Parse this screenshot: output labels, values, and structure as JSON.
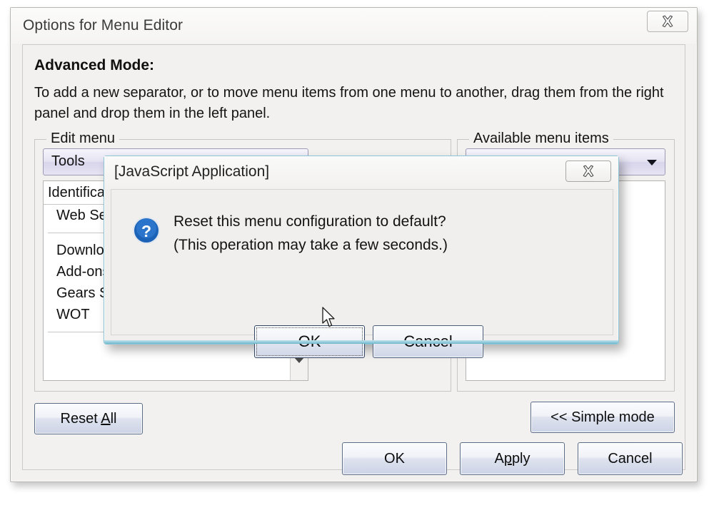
{
  "window": {
    "title": "Options for Menu Editor",
    "close_icon": "close-icon"
  },
  "content": {
    "heading": "Advanced Mode:",
    "description": "To add a new separator, or to move menu items from one menu to another, drag them from the right panel and drop them in the left panel."
  },
  "left_panel": {
    "group_label": "Edit menu",
    "combo_value": "Tools",
    "combo_arrow_icon": "chevron-down-icon",
    "list_header": "Identification",
    "items": [
      {
        "label": "Web Services"
      },
      {
        "label": "Downloads"
      },
      {
        "label": "Add-ons"
      },
      {
        "label": "Gears Settings"
      },
      {
        "label": "WOT"
      }
    ],
    "scroll_down_icon": "chevron-down-icon"
  },
  "right_panel": {
    "group_label": "Available menu items",
    "combo_value": "",
    "combo_arrow_icon": "chevron-down-icon",
    "items": []
  },
  "footer": {
    "reset_all": "Reset All",
    "reset_all_accel": "A",
    "simple_mode": "<< Simple mode",
    "ok": "OK",
    "apply": "Apply",
    "apply_accel": "p",
    "cancel": "Cancel"
  },
  "dialog": {
    "title": "[JavaScript Application]",
    "close_icon": "close-icon",
    "icon": "question-mark-icon",
    "message_line1": "Reset this menu configuration to default?",
    "message_line2": "(This operation may take a few seconds.)",
    "ok": "OK",
    "cancel": "Cancel"
  },
  "colors": {
    "dialog_border": "#8fc6d6",
    "combo_accent": "#9d9ab6",
    "question_icon": "#1c63b8",
    "wot_mark": "#9d1b1b"
  },
  "cursor": {
    "icon": "mouse-pointer-icon"
  }
}
